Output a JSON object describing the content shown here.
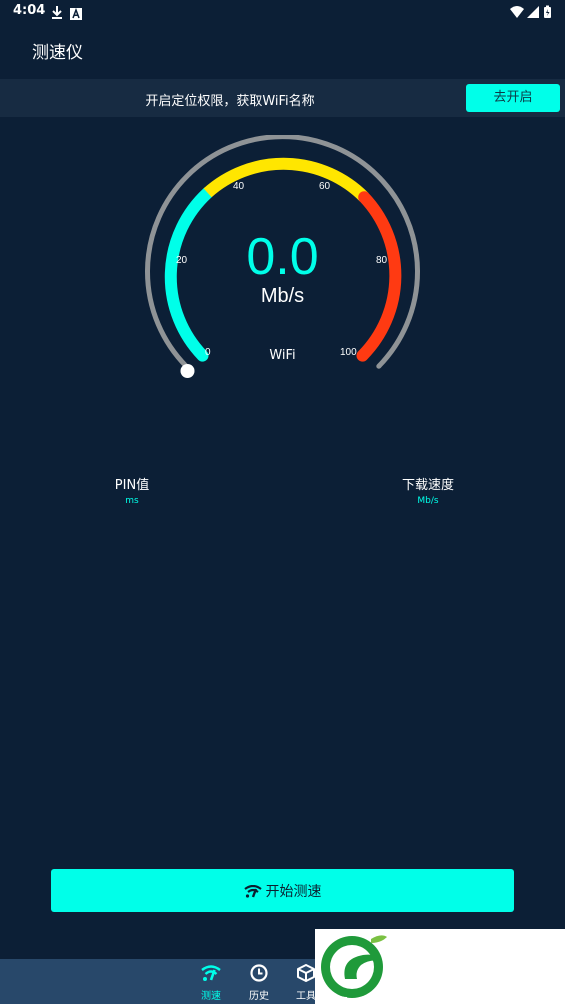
{
  "status_bar": {
    "time": "4:04",
    "icons": [
      "download-icon",
      "a-icon",
      "wifi-icon",
      "signal-icon",
      "battery-icon"
    ]
  },
  "header": {
    "title": "测速仪"
  },
  "permission_banner": {
    "text": "开启定位权限，获取WiFi名称",
    "button_label": "去开启"
  },
  "gauge": {
    "value": "0.0",
    "unit": "Mb/s",
    "connection": "WiFi",
    "ticks": [
      "0",
      "20",
      "40",
      "60",
      "80",
      "100"
    ],
    "colors": {
      "low": "#00ffe9",
      "mid": "#ffe600",
      "high": "#ff3a12",
      "track": "#8f9396"
    }
  },
  "metrics": [
    {
      "label": "PIN值",
      "unit": "ms"
    },
    {
      "label": "下载速度",
      "unit": "Mb/s"
    }
  ],
  "start_button": {
    "label": "开始测速",
    "icon": "wifi-icon"
  },
  "bottom_nav": {
    "items": [
      {
        "label": "测速",
        "icon": "wifi-icon",
        "active": true
      },
      {
        "label": "历史",
        "icon": "clock-icon",
        "active": false
      },
      {
        "label": "工具",
        "icon": "box-icon",
        "active": false
      }
    ]
  },
  "colors": {
    "background": "#0c1f36",
    "accent": "#00ffe9",
    "nav_bg": "#28486a"
  }
}
